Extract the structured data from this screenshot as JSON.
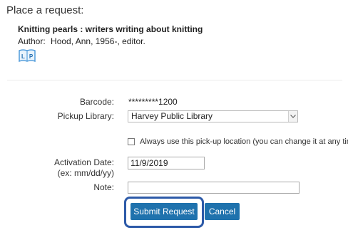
{
  "heading": "Place a request:",
  "item": {
    "title": "Knitting pearls : writers writing about knitting",
    "author_label": "Author:",
    "author_value": "Hood, Ann, 1956-, editor.",
    "format_icon_text": "LP"
  },
  "form": {
    "barcode_label": "Barcode:",
    "barcode_value": "*********1200",
    "pickup_label": "Pickup Library:",
    "pickup_value": "Harvey Public Library",
    "always_use_label": "Always use this pick-up location (you can change it at any time)?",
    "always_use_checked": false,
    "activation_label": "Activation Date:",
    "activation_hint": "(ex: mm/dd/yy)",
    "activation_value": "11/9/2019",
    "note_label": "Note:",
    "note_value": ""
  },
  "buttons": {
    "submit": "Submit Request",
    "cancel": "Cancel"
  },
  "colors": {
    "button": "#1f72ad",
    "highlight": "#2d5aa8",
    "icon": "#3a8fd6"
  },
  "icons": {
    "format": "large-print-book-icon",
    "dropdown": "chevron-down-icon"
  }
}
